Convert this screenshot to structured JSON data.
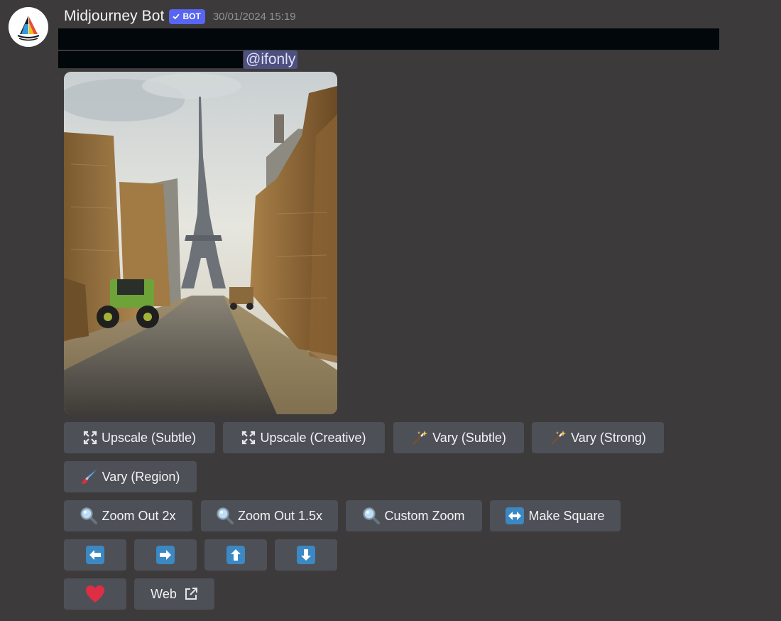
{
  "message": {
    "author": "Midjourney Bot",
    "bot_badge": "BOT",
    "timestamp": "30/01/2024 15:19",
    "mention": "@ifonly"
  },
  "buttons": {
    "row1": [
      {
        "label": "Upscale (Subtle)",
        "icon": "upscale-icon"
      },
      {
        "label": "Upscale (Creative)",
        "icon": "upscale-icon"
      },
      {
        "label": "Vary (Subtle)",
        "icon": "magic-wand-icon"
      },
      {
        "label": "Vary (Strong)",
        "icon": "magic-wand-icon"
      }
    ],
    "row2": [
      {
        "label": "Vary (Region)",
        "icon": "paintbrush-icon"
      }
    ],
    "row3": [
      {
        "label": "Zoom Out 2x",
        "icon": "magnifier-icon"
      },
      {
        "label": "Zoom Out 1.5x",
        "icon": "magnifier-icon"
      },
      {
        "label": "Custom Zoom",
        "icon": "magnifier-icon"
      },
      {
        "label": "Make Square",
        "icon": "left-right-arrow-icon"
      }
    ],
    "row4": [
      {
        "icon": "arrow-left-icon"
      },
      {
        "icon": "arrow-right-icon"
      },
      {
        "icon": "arrow-up-icon"
      },
      {
        "icon": "arrow-down-icon"
      }
    ],
    "row5": [
      {
        "icon": "heart-icon"
      },
      {
        "label": "Web",
        "icon": "external-link-icon"
      }
    ]
  },
  "colors": {
    "background": "#3c3a3a",
    "button": "#4e5058",
    "bot_badge": "#5865f2",
    "mention_bg": "#4e507e",
    "arrow_key": "#3b88c3",
    "heart": "#dd2e44"
  }
}
